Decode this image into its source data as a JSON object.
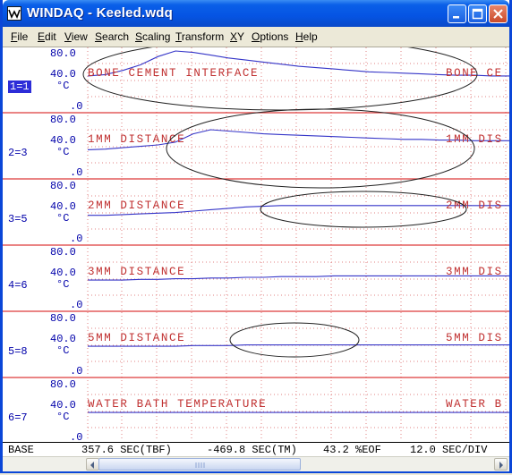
{
  "window": {
    "title": "WINDAQ - Keeled.wdq"
  },
  "menu": {
    "items": [
      "File",
      "Edit",
      "View",
      "Search",
      "Scaling",
      "Transform",
      "XY",
      "Options",
      "Help"
    ]
  },
  "channels": [
    {
      "label": "1=1",
      "active": true,
      "ymax": "80.0",
      "ymid": "40.0",
      "unit": "°C",
      "ymin": ".0",
      "annotation": "BONE CEMENT INTERFACE",
      "annotation_repeat": "BONE CE"
    },
    {
      "label": "2=3",
      "active": false,
      "ymax": "80.0",
      "ymid": "40.0",
      "unit": "°C",
      "ymin": ".0",
      "annotation": "1MM DISTANCE",
      "annotation_repeat": "1MM DIS"
    },
    {
      "label": "3=5",
      "active": false,
      "ymax": "80.0",
      "ymid": "40.0",
      "unit": "°C",
      "ymin": ".0",
      "annotation": "2MM DISTANCE",
      "annotation_repeat": "2MM DIS"
    },
    {
      "label": "4=6",
      "active": false,
      "ymax": "80.0",
      "ymid": "40.0",
      "unit": "°C",
      "ymin": ".0",
      "annotation": "3MM DISTANCE",
      "annotation_repeat": "3MM DIS"
    },
    {
      "label": "5=8",
      "active": false,
      "ymax": "80.0",
      "ymid": "40.0",
      "unit": "°C",
      "ymin": ".0",
      "annotation": "5MM DISTANCE",
      "annotation_repeat": "5MM DIS"
    },
    {
      "label": "6=7",
      "active": false,
      "ymax": "80.0",
      "ymid": "40.0",
      "unit": "°C",
      "ymin": ".0",
      "annotation": "WATER BATH TEMPERATURE",
      "annotation_repeat": "WATER B"
    }
  ],
  "status": {
    "base": "BASE",
    "time_before": "357.6 SEC(TBF)",
    "time_marker": "-469.8 SEC(TM)",
    "eof": "43.2 %EOF",
    "div": "12.0 SEC/DIV"
  },
  "colors": {
    "trace": "#3535c8",
    "grid_red": "#dd3a3a",
    "grid_dot": "#e08080",
    "axis_blue": "#0000aa",
    "titlebar": "#0554e3"
  },
  "chart_data": {
    "type": "line",
    "x_axis_unit": "SEC",
    "y_unit": "°C",
    "ylim": [
      0,
      80
    ],
    "series": [
      {
        "name": "BONE CEMENT INTERFACE",
        "values": [
          44,
          46,
          52,
          60,
          72,
          80,
          78,
          74,
          70,
          67,
          64,
          61,
          58,
          56,
          54,
          52,
          50,
          49,
          48,
          47,
          46,
          45,
          45,
          44,
          44
        ]
      },
      {
        "name": "1MM DISTANCE",
        "values": [
          33,
          34,
          36,
          38,
          40,
          44,
          56,
          62,
          60,
          58,
          56,
          55,
          54,
          53,
          52,
          51,
          50,
          49,
          48,
          48,
          47,
          47,
          46,
          46,
          46
        ]
      },
      {
        "name": "2MM DISTANCE",
        "values": [
          34,
          34,
          35,
          36,
          37,
          38,
          40,
          42,
          44,
          46,
          47,
          48,
          48,
          48,
          48,
          48,
          48,
          48,
          48,
          48,
          48,
          48,
          48,
          48,
          48
        ]
      },
      {
        "name": "3MM DISTANCE",
        "values": [
          36,
          36,
          36,
          37,
          37,
          38,
          38,
          39,
          39,
          40,
          40,
          41,
          41,
          41,
          42,
          42,
          42,
          42,
          42,
          42,
          42,
          42,
          42,
          42,
          42
        ]
      },
      {
        "name": "5MM DISTANCE",
        "values": [
          36,
          36,
          36,
          36,
          36,
          36,
          37,
          37,
          37,
          38,
          38,
          38,
          38,
          38,
          38,
          38,
          38,
          38,
          38,
          38,
          38,
          38,
          38,
          38,
          38
        ]
      },
      {
        "name": "WATER BATH TEMPERATURE",
        "values": [
          36,
          36,
          36,
          36,
          36,
          36,
          36,
          36,
          36,
          36,
          36,
          36,
          36,
          36,
          36,
          36,
          36,
          36,
          36,
          36,
          36,
          36,
          36,
          36,
          36
        ]
      }
    ]
  }
}
